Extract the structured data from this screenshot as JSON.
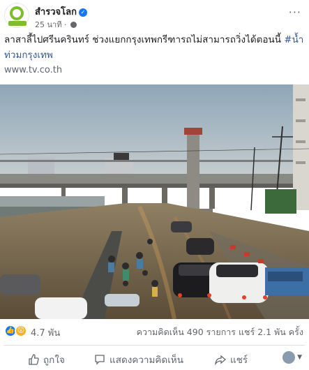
{
  "post": {
    "page_name": "สำรวจโลก",
    "avatar_text": "สำรวจโลก",
    "time": "25 นาที",
    "caption_text": "ลาสาลี้ไปศรีนครินทร์ ช่วงแยกกรุงเทพกรีฑารถไม่สามารถวิ่งได้ตอนนี้ ",
    "caption_tag": "#น้ำท่วมกรุงเทพ",
    "link_text": "www.tv.co.th"
  },
  "engagement": {
    "reaction_count": "4.7 พัน",
    "stats_text": "ความคิดเห็น 490 รายการ  แชร์ 2.1 พัน ครั้ง"
  },
  "actions": {
    "like_label": "ถูกใจ",
    "comment_label": "แสดงความคิดเห็น",
    "share_label": "แชร์"
  },
  "colors": {
    "accent": "#1877f2",
    "hashtag": "#385898",
    "logo_green": "#7dbd2e"
  },
  "icons": [
    "verified-badge-icon",
    "globe-icon",
    "more-icon",
    "like-icon",
    "wow-icon",
    "thumb-up-icon",
    "comment-icon",
    "share-icon"
  ]
}
